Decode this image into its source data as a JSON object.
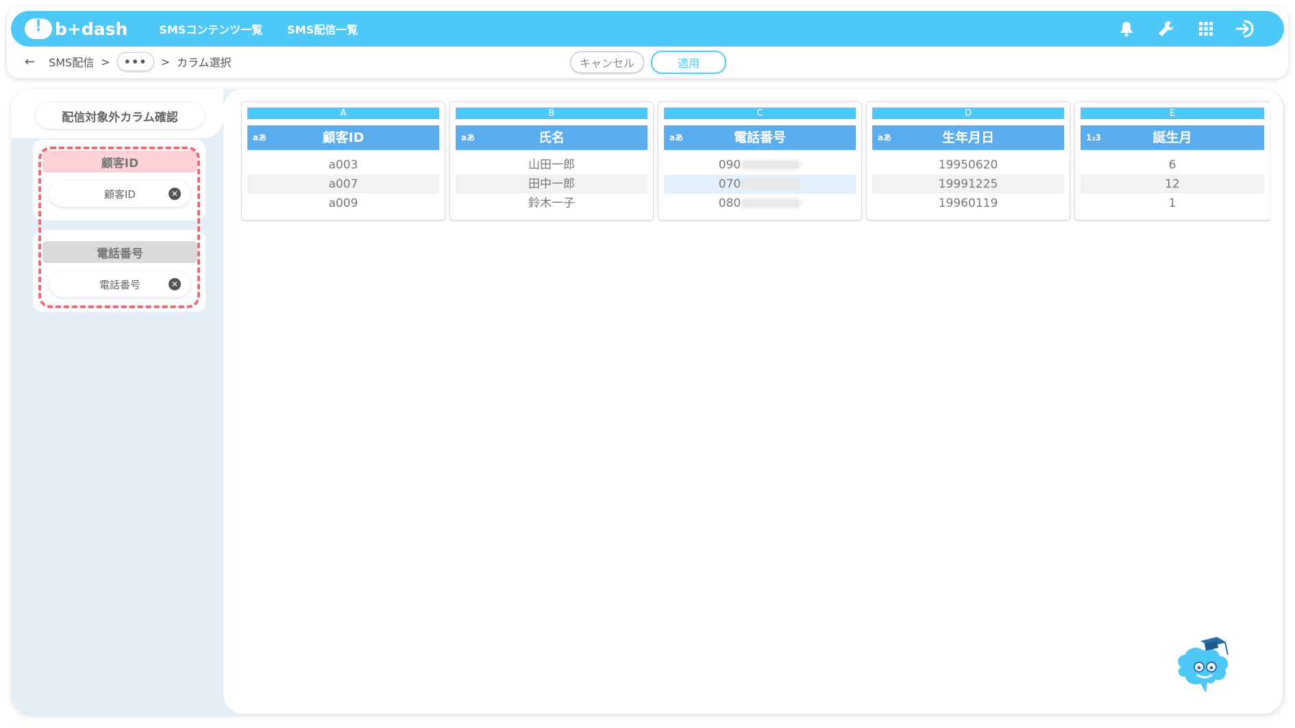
{
  "header": {
    "logo_text": "b+dash",
    "nav": [
      "SMSコンテンツ一覧",
      "SMS配信一覧"
    ],
    "icons": [
      "bell-icon",
      "wrench-icon",
      "grid-icon",
      "logout-icon"
    ]
  },
  "breadcrumb": {
    "back_icon": "←",
    "root": "SMS配信",
    "sep": ">",
    "more": "•••",
    "current": "カラム選択"
  },
  "actions": {
    "cancel": "キャンセル",
    "apply": "適用"
  },
  "sidebar": {
    "title": "配信対象外カラム確認",
    "groups": [
      {
        "header": "顧客ID",
        "chip": "顧客ID"
      },
      {
        "header": "電話番号",
        "chip": "電話番号"
      }
    ]
  },
  "columns": [
    {
      "letter": "A",
      "type": "aあ",
      "name": "顧客ID",
      "values": [
        "a003",
        "a007",
        "a009"
      ]
    },
    {
      "letter": "B",
      "type": "aあ",
      "name": "氏名",
      "values": [
        "山田一郎",
        "田中一郎",
        "鈴木一子"
      ]
    },
    {
      "letter": "C",
      "type": "aあ",
      "name": "電話番号",
      "values": [
        "090",
        "070",
        "080"
      ]
    },
    {
      "letter": "D",
      "type": "aあ",
      "name": "生年月日",
      "values": [
        "19950620",
        "19991225",
        "19960119"
      ]
    },
    {
      "letter": "E",
      "type": "1₂3",
      "name": "誕生月",
      "values": [
        "6",
        "12",
        "1"
      ]
    }
  ],
  "colors": {
    "brand": "#4ec9f7",
    "header_blue": "#5aaef0",
    "dashed_red": "#ee6a77"
  }
}
